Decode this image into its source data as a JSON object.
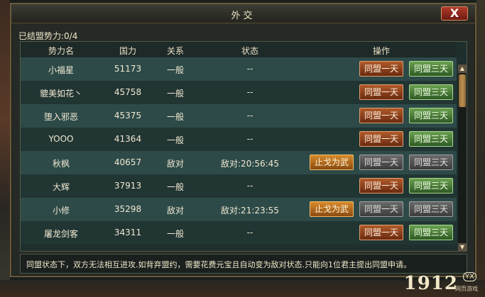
{
  "window": {
    "title": "外交",
    "close_label": "X"
  },
  "alliance_count": "已结盟势力:0/4",
  "table": {
    "headers": [
      "势力名",
      "国力",
      "关系",
      "状态",
      "操作"
    ],
    "rows": [
      {
        "name": "小福星",
        "power": "51173",
        "relation": "一般",
        "status": "--",
        "stop_war": "",
        "ally_1day": "同盟一天",
        "ally_3day": "同盟三天",
        "disabled": false
      },
      {
        "name": "貔美如花丶",
        "power": "45758",
        "relation": "一般",
        "status": "--",
        "stop_war": "",
        "ally_1day": "同盟一天",
        "ally_3day": "同盟三天",
        "disabled": false
      },
      {
        "name": "堕入邪恶",
        "power": "45375",
        "relation": "一般",
        "status": "--",
        "stop_war": "",
        "ally_1day": "同盟一天",
        "ally_3day": "同盟三天",
        "disabled": false
      },
      {
        "name": "YOOO",
        "power": "41364",
        "relation": "一般",
        "status": "--",
        "stop_war": "",
        "ally_1day": "同盟一天",
        "ally_3day": "同盟三天",
        "disabled": false
      },
      {
        "name": "秋枫",
        "power": "40657",
        "relation": "敌对",
        "status": "敌对:20:56:45",
        "stop_war": "止戈为武",
        "ally_1day": "同盟一天",
        "ally_3day": "同盟三天",
        "disabled": true
      },
      {
        "name": "大辉",
        "power": "37913",
        "relation": "一般",
        "status": "--",
        "stop_war": "",
        "ally_1day": "同盟一天",
        "ally_3day": "同盟三天",
        "disabled": false
      },
      {
        "name": "小修",
        "power": "35298",
        "relation": "敌对",
        "status": "敌对:21:23:55",
        "stop_war": "止戈为武",
        "ally_1day": "同盟一天",
        "ally_3day": "同盟三天",
        "disabled": true
      },
      {
        "name": "屠龙剑客",
        "power": "34311",
        "relation": "一般",
        "status": "--",
        "stop_war": "",
        "ally_1day": "同盟一天",
        "ally_3day": "同盟三天",
        "disabled": false
      }
    ]
  },
  "notice": "同盟状态下，双方无法相互进攻.如背弃盟约，需要花费元宝且自动变为敌对状态.只能向1位君主提出同盟申请。",
  "logo": {
    "main": "1912",
    "badge": "YX",
    "sub": "网页游戏"
  },
  "scrollbar": {
    "up": "▲",
    "down": "▼"
  }
}
